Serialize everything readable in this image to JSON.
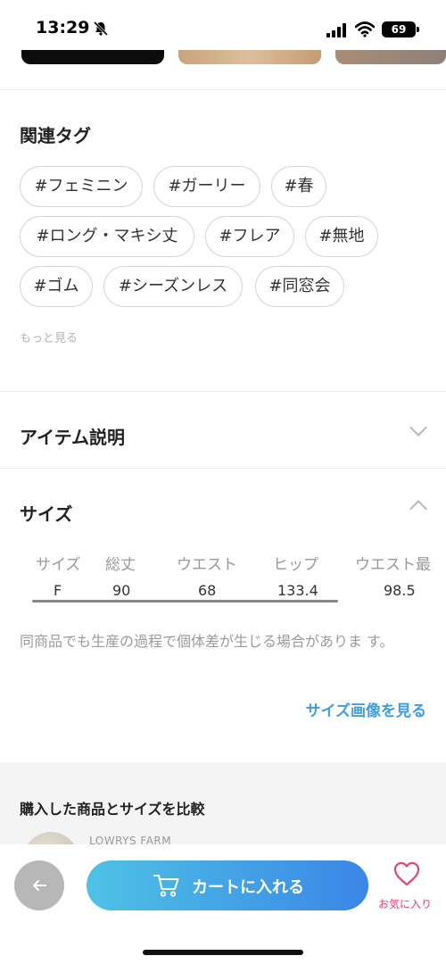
{
  "status_bar": {
    "time": "13:29",
    "battery": "69"
  },
  "related_tags": {
    "title": "関連タグ",
    "tags": [
      "#フェミニン",
      "#ガーリー",
      "#春",
      "#ロング・マキシ丈",
      "#フレア",
      "#無地",
      "#ゴム",
      "#シーズンレス",
      "#同窓会"
    ],
    "more": "もっと見る"
  },
  "item_description": {
    "title": "アイテム説明"
  },
  "size": {
    "title": "サイズ",
    "headers": [
      "サイズ",
      "総丈",
      "ウエスト",
      "ヒップ",
      "ウエスト最"
    ],
    "row": [
      "F",
      "90",
      "68",
      "133.4",
      "98.5"
    ],
    "note": "同商品でも生産の過程で個体差が生じる場合がありま す。",
    "image_link": "サイズ画像を見る"
  },
  "compare": {
    "title": "購入した商品とサイズを比較",
    "brand": "LOWRYS FARM"
  },
  "bottom_bar": {
    "cart_label": "カートに入れる",
    "favorite_label": "お気に入り"
  },
  "colors": {
    "accent_blue": "#3f9de0",
    "cart_gradient_start": "#4ec2e6",
    "cart_gradient_end": "#3a86e6",
    "favorite_pink": "#e0467a"
  }
}
